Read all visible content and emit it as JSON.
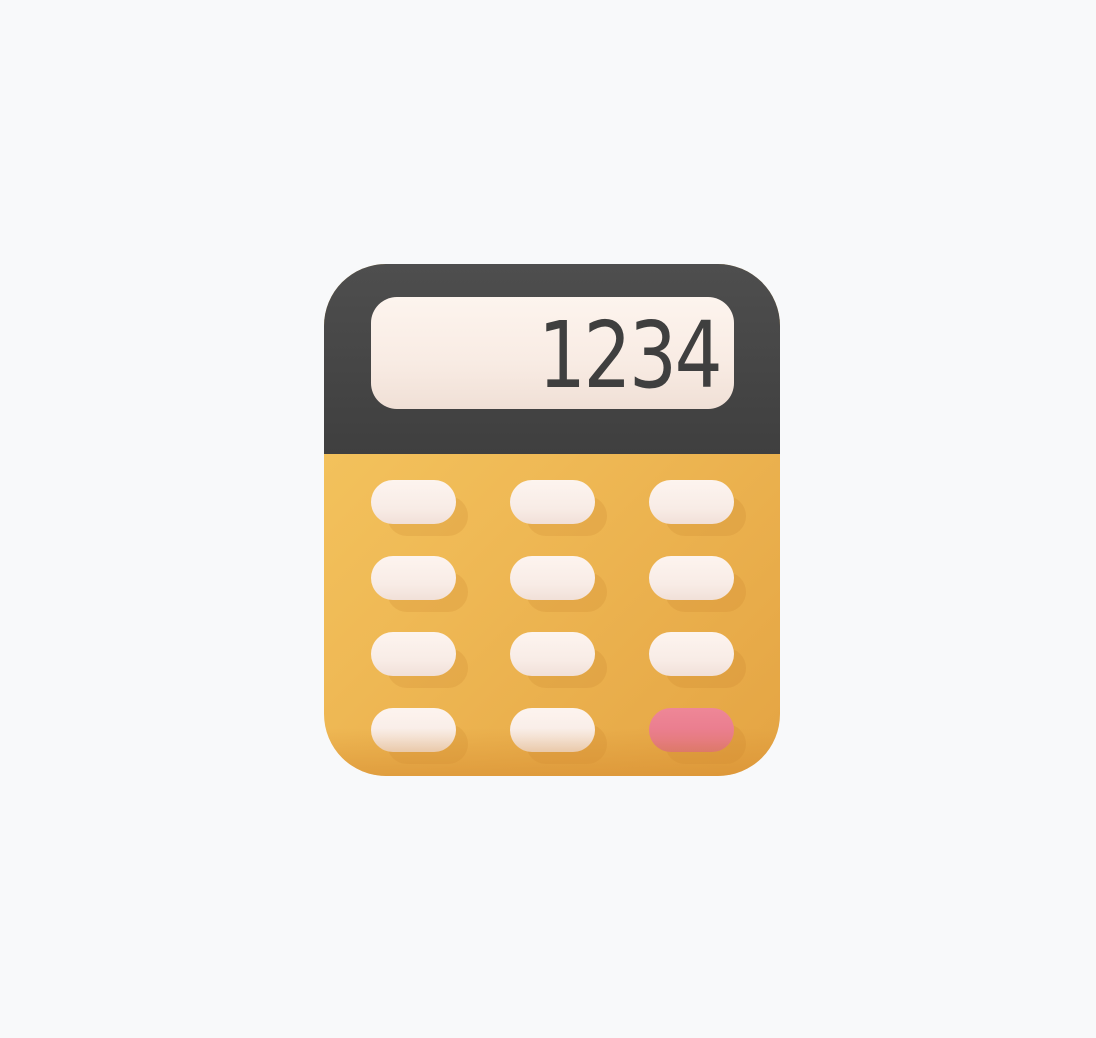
{
  "display": {
    "value": "1234"
  },
  "colors": {
    "body": "#f2bf5a",
    "header": "#474747",
    "display": "#fbf0e9",
    "key": "#fbf0ea",
    "accent_key": "#ea7f90",
    "text": "#3f3f3f"
  },
  "keys": [
    {
      "name": "key-1",
      "type": "standard"
    },
    {
      "name": "key-2",
      "type": "standard"
    },
    {
      "name": "key-3",
      "type": "standard"
    },
    {
      "name": "key-4",
      "type": "standard"
    },
    {
      "name": "key-5",
      "type": "standard"
    },
    {
      "name": "key-6",
      "type": "standard"
    },
    {
      "name": "key-7",
      "type": "standard"
    },
    {
      "name": "key-8",
      "type": "standard"
    },
    {
      "name": "key-9",
      "type": "standard"
    },
    {
      "name": "key-10",
      "type": "standard"
    },
    {
      "name": "key-11",
      "type": "standard"
    },
    {
      "name": "key-12",
      "type": "accent"
    }
  ]
}
